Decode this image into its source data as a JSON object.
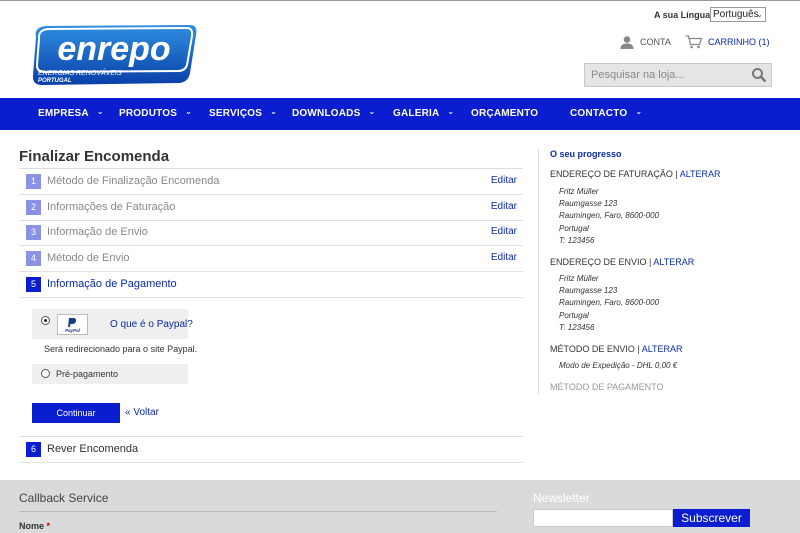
{
  "header": {
    "language_label": "A sua Língua:",
    "language_selected": "Português",
    "account_label": "CONTA",
    "cart_label": "CARRINHO (1)",
    "search_placeholder": "Pesquisar na loja...",
    "logo_text": "enrepo",
    "logo_subtitle": "ENERGIAS RENOVÁVEIS",
    "logo_country": "PORTUGAL"
  },
  "nav": {
    "items": [
      "EMPRESA",
      "PRODUTOS",
      "SERVIÇOS",
      "DOWNLOADS",
      "GALERIA",
      "ORÇAMENTO",
      "CONTACTO"
    ]
  },
  "checkout": {
    "title": "Finalizar Encomenda",
    "steps": [
      {
        "number": "1",
        "label": "Método de Finalização Encomenda",
        "edit": "Editar"
      },
      {
        "number": "2",
        "label": "Informações de Faturação",
        "edit": "Editar"
      },
      {
        "number": "3",
        "label": "Informação de Envio",
        "edit": "Editar"
      },
      {
        "number": "4",
        "label": "Método de Envio",
        "edit": "Editar"
      },
      {
        "number": "5",
        "label": "Informação de Pagamento"
      },
      {
        "number": "6",
        "label": "Rever Encomenda"
      }
    ],
    "payment": {
      "paypal_link": "O que é o Paypal?",
      "redirect_note": "Será redirecionado para o site Paypal.",
      "prepayment_label": "Pré-pagamento"
    },
    "continue_label": "Continuar",
    "back_label": "« Voltar"
  },
  "progress": {
    "title": "O seu progresso",
    "change_label": "ALTERAR",
    "billing_heading": "ENDEREÇO DE FATURAÇÃO",
    "billing_lines": [
      "Fritz Müller",
      "Raumgasse 123",
      "Raumingen, Faro, 8600-000",
      "Portugal",
      "T: 123456"
    ],
    "shipping_heading": "ENDEREÇO DE ENVIO",
    "shipping_lines": [
      "Fritz Müller",
      "Raumgasse 123",
      "Raumingen, Faro, 8600-000",
      "Portugal",
      "T: 123456"
    ],
    "shipping_method_heading": "MÉTODO DE ENVIO",
    "shipping_method_value": "Modo de Expedição - DHL 0,00 €",
    "payment_method_heading": "MÉTODO DE PAGAMENTO"
  },
  "footer": {
    "callback_title": "Callback Service",
    "name_label": "Nome",
    "required_mark": "*",
    "newsletter_title": "Newsletter",
    "subscribe_label": "Subscrever"
  },
  "colors": {
    "brand_blue": "#0a1ecf",
    "link_blue": "#0b2ba5",
    "footer_bg": "#d9dadc"
  }
}
